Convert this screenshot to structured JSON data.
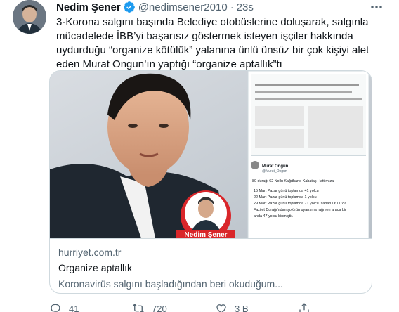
{
  "tweet": {
    "author_name": "Nedim Şener",
    "handle": "@nedimsener2010",
    "separator": "·",
    "time": "23s",
    "text": "3-Korona salgını başında Belediye otobüslerine doluşarak, salgınla mücadelede İBB’yi başarısız göstermek isteyen işçiler hakkında uydurduğu “organize kötülük” yalanına ünlü ünsüz bir çok kişiyi alet eden Murat Ongun’ın yaptığı “organize aptallık”tı",
    "icons": {
      "verified": "verified-badge-icon",
      "more": "more-icon",
      "avatar": "avatar"
    }
  },
  "card": {
    "domain": "hurriyet.com.tr",
    "title": "Organize aptallık",
    "description": "Koronavirüs salgını başladığından beri okuduğum...",
    "image_overlay": {
      "name_tag": "Nedim Şener",
      "inset_header": "Murat Ongun",
      "inset_handle": "@Murat_Ongun",
      "inset_line": "80 durağı 62 No'lu Kağıthane-Kabataş Hattımıza",
      "inset_rows": [
        "15 Mart Pazar günü  toplamda 41 yolcu",
        "22 Mart  Pazar günü toplamda 1 yolcu",
        "29 Mart Pazar günü toplamda 71 yolcu. sabah 06.00'da",
        "Fazilet Durağı'ndan şoförün uyarısına rağmen araca bir",
        "anda 47 yolcu binmiştir."
      ]
    }
  },
  "actions": {
    "reply": {
      "count": "41",
      "icon": "reply-icon"
    },
    "retweet": {
      "count": "720",
      "icon": "retweet-icon"
    },
    "like": {
      "count": "3 B",
      "icon": "like-icon"
    },
    "share": {
      "count": "",
      "icon": "share-icon"
    }
  },
  "colors": {
    "verified": "#1d9bf0",
    "text_secondary": "#536471",
    "border": "#cfd9de"
  }
}
